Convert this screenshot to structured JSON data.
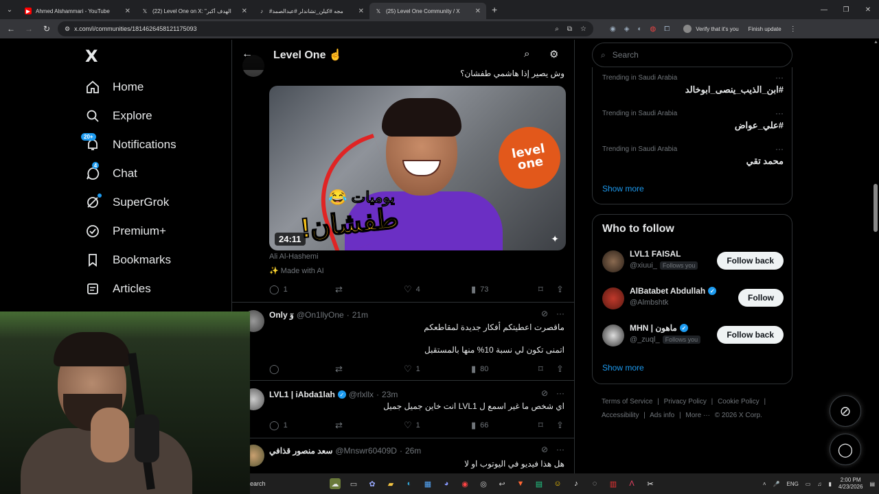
{
  "browser": {
    "tabs": [
      {
        "title": "Ahmed Alshammari - YouTube",
        "favicon": "youtube-icon",
        "color": "#ff0000"
      },
      {
        "title": "(22) Level One on X: \"الهدف أكبر",
        "favicon": "x-icon",
        "color": "#ffffff"
      },
      {
        "title": "#مجه #كيلن_تشاندلر #عبدالصمد",
        "favicon": "tiktok-icon",
        "color": "#ffffff"
      },
      {
        "title": "(25) Level One Community / X",
        "favicon": "x-icon",
        "color": "#ffffff"
      }
    ],
    "url": "x.com/i/communities/1814626458121175093",
    "profile_label": "Verify that it's you",
    "update_label": "Finish update"
  },
  "nav": {
    "logo": "X",
    "items": [
      {
        "label": "Home",
        "icon": "home-icon"
      },
      {
        "label": "Explore",
        "icon": "search-icon"
      },
      {
        "label": "Notifications",
        "icon": "bell-icon",
        "badge": "20+"
      },
      {
        "label": "Chat",
        "icon": "chat-icon",
        "badge": "4"
      },
      {
        "label": "SuperGrok",
        "icon": "grok-icon"
      },
      {
        "label": "Premium+",
        "icon": "premium-icon"
      },
      {
        "label": "Bookmarks",
        "icon": "bookmark-icon"
      },
      {
        "label": "Articles",
        "icon": "articles-icon"
      }
    ]
  },
  "header": {
    "title": "Level One ☝️"
  },
  "post1": {
    "text": "وش يصير إذا هاشمي طفشان؟",
    "video": {
      "duration": "24:11",
      "overlay_line1": "يوميات 😂",
      "overlay_line2": "طفشان!",
      "logo_text": "level one"
    },
    "credit": "Ali Al-Hashemi",
    "ai_label": "Made with AI",
    "replies": "1",
    "likes": "4",
    "views": "73"
  },
  "replies": [
    {
      "name": "Only وٓ",
      "handle": "@On1llyOne",
      "time": "21m",
      "verified": false,
      "lines": [
        "ماقصرت اعطيتكم أفكار جديدة لمقاطعكم",
        "اتمنى تكون لي نسبة 10% منها بالمستقبل"
      ],
      "replies": "",
      "likes": "1",
      "views": "80"
    },
    {
      "name": "LVL1 | iAbda1lah",
      "handle": "@rlxllx",
      "time": "23m",
      "verified": true,
      "lines": [
        "اي شخص ما غير اسمع ل LVL1 انت خاين جميل جميل"
      ],
      "replies": "1",
      "likes": "1",
      "views": "66"
    },
    {
      "name": "سعد منصور قذافي",
      "handle": "@Mnswr60409D",
      "time": "26m",
      "verified": false,
      "lines": [
        "هل هذا فيديو في اليوتوب او لا"
      ],
      "replies": "",
      "likes": "",
      "views": ""
    }
  ],
  "sidebar": {
    "search_placeholder": "Search",
    "trends": [
      {
        "context": "Trending in Saudi Arabia",
        "topic": "#ابن_الذيب_ينصى_ابوخالد"
      },
      {
        "context": "Trending in Saudi Arabia",
        "topic": "#علي_عواض"
      },
      {
        "context": "Trending in Saudi Arabia",
        "topic": "محمد تقي"
      }
    ],
    "show_more": "Show more",
    "who_to_follow_title": "Who to follow",
    "follow": [
      {
        "name": "LVL1 FAISAL",
        "handle": "@xiuui_",
        "follows_you": "Follows you",
        "verified": false,
        "button": "Follow back"
      },
      {
        "name": "AlBatabet Abdullah",
        "handle": "@Almbshtk",
        "follows_you": "",
        "verified": true,
        "button": "Follow"
      },
      {
        "name": "MHN | ماهون",
        "handle": "@_zuql_",
        "follows_you": "Follows you",
        "verified": true,
        "button": "Follow back"
      }
    ],
    "footer": [
      "Terms of Service",
      "|",
      "Privacy Policy",
      "|",
      "Cookie Policy",
      "|",
      "Accessibility",
      "|",
      "Ads info",
      "|",
      "More ···",
      "© 2026 X Corp."
    ]
  },
  "taskbar": {
    "search_label": "earch",
    "lang": "ENG",
    "time": "2:00 PM",
    "date": "4/23/2026"
  }
}
